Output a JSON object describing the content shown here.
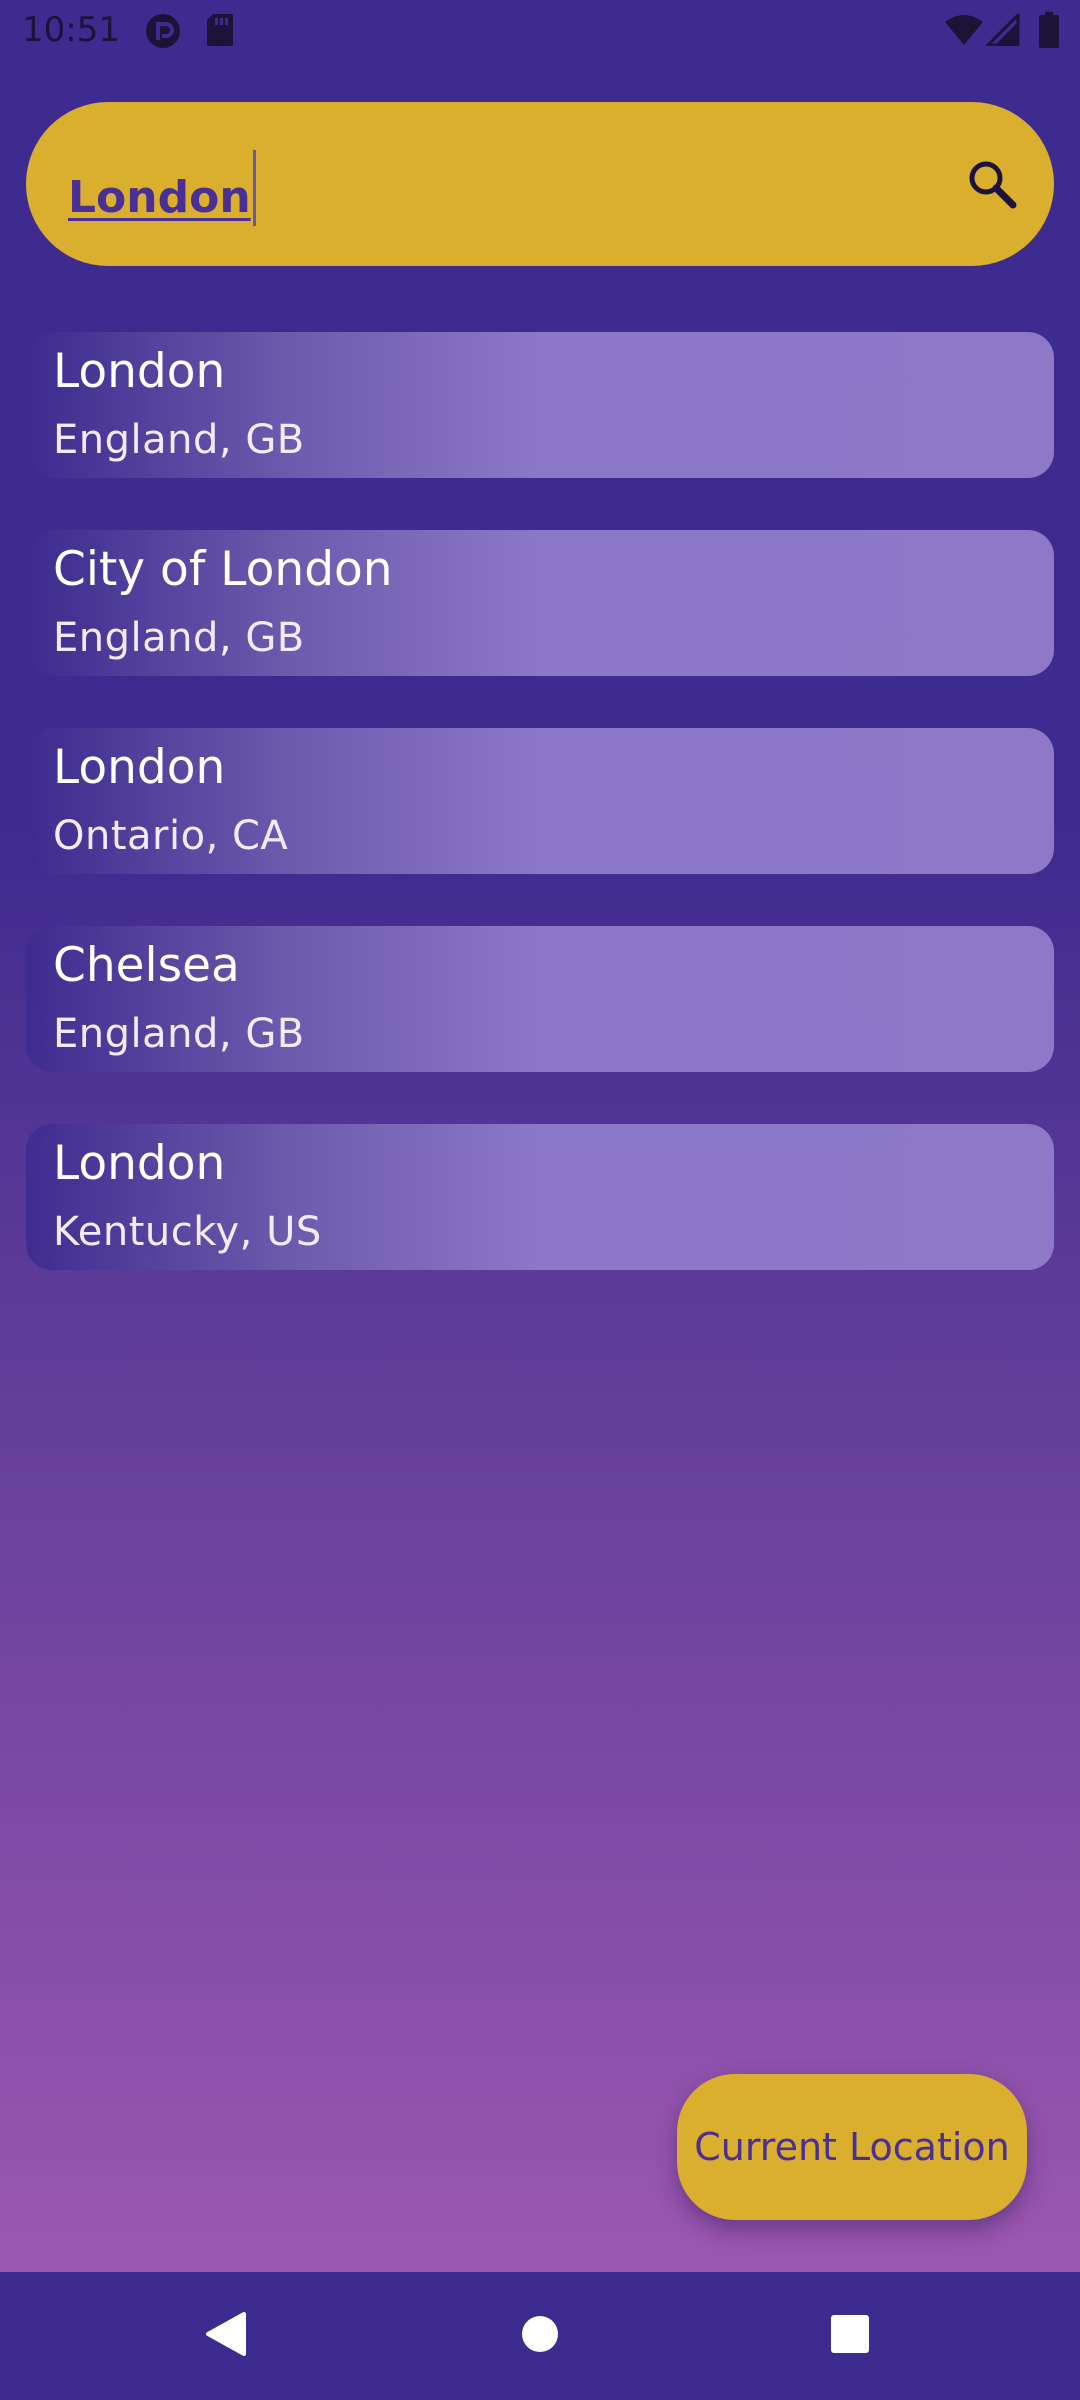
{
  "status_bar": {
    "time": "10:51",
    "left_icons": [
      "pocket-casts-icon",
      "sd-card-icon"
    ],
    "right_icons": [
      "wifi-icon",
      "signal-icon",
      "battery-icon"
    ]
  },
  "search": {
    "value": "London",
    "icon": "search-icon"
  },
  "results": [
    {
      "name": "London",
      "region": "England, GB"
    },
    {
      "name": "City of London",
      "region": "England, GB"
    },
    {
      "name": "London",
      "region": "Ontario, CA"
    },
    {
      "name": "Chelsea",
      "region": "England, GB"
    },
    {
      "name": "London",
      "region": "Kentucky, US"
    }
  ],
  "current_location_button": {
    "label": "Current Location"
  },
  "nav_bar": {
    "buttons": [
      "back-icon",
      "home-icon",
      "recents-icon"
    ]
  },
  "colors": {
    "background_top": "#3d2b8f",
    "background_bottom": "#9b57b0",
    "accent_yellow": "#dbaf2e",
    "accent_text": "#4a2f97",
    "card": "#8d79c8"
  }
}
